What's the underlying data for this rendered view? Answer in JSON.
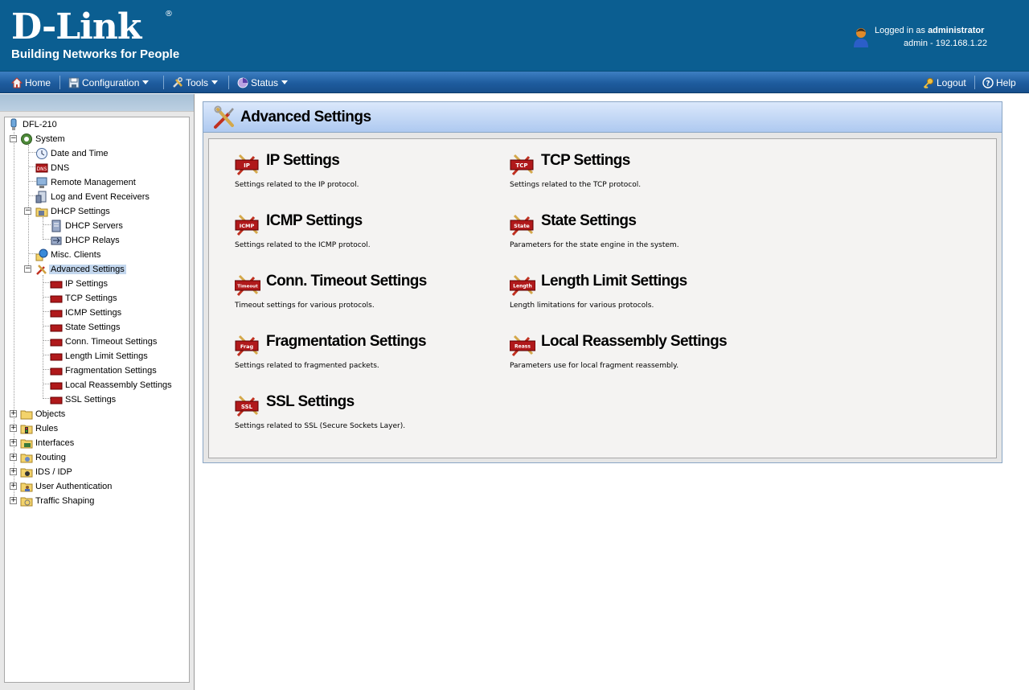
{
  "header": {
    "logo_text": "D-Link",
    "logo_reg": "®",
    "tagline": "Building Networks for People",
    "logged_in_prefix": "Logged in as",
    "username": "administrator",
    "session": "admin - 192.168.1.22"
  },
  "menu": {
    "home": "Home",
    "configuration": "Configuration",
    "tools": "Tools",
    "status": "Status",
    "logout": "Logout",
    "help": "Help"
  },
  "tree": {
    "root": "DFL-210",
    "system": "System",
    "date_time": "Date and Time",
    "dns": "DNS",
    "remote_mgmt": "Remote Management",
    "log_receivers": "Log and Event Receivers",
    "dhcp_settings": "DHCP Settings",
    "dhcp_servers": "DHCP Servers",
    "dhcp_relays": "DHCP Relays",
    "misc_clients": "Misc. Clients",
    "advanced_settings": "Advanced Settings",
    "ip_settings": "IP Settings",
    "tcp_settings": "TCP Settings",
    "icmp_settings": "ICMP Settings",
    "state_settings": "State Settings",
    "conn_timeout": "Conn. Timeout Settings",
    "length_limit": "Length Limit Settings",
    "fragmentation": "Fragmentation Settings",
    "local_reassembly": "Local Reassembly Settings",
    "ssl_settings": "SSL Settings",
    "objects": "Objects",
    "rules": "Rules",
    "interfaces": "Interfaces",
    "routing": "Routing",
    "ids_idp": "IDS / IDP",
    "user_auth": "User Authentication",
    "traffic_shaping": "Traffic Shaping"
  },
  "panel": {
    "title": "Advanced Settings",
    "settings": [
      {
        "badge": "IP",
        "title": "IP Settings",
        "desc": "Settings related to the IP protocol."
      },
      {
        "badge": "TCP",
        "title": "TCP Settings",
        "desc": "Settings related to the TCP protocol."
      },
      {
        "badge": "ICMP",
        "title": "ICMP Settings",
        "desc": "Settings related to the ICMP protocol."
      },
      {
        "badge": "State",
        "title": "State Settings",
        "desc": "Parameters for the state engine in the system."
      },
      {
        "badge": "Timeout",
        "title": "Conn. Timeout Settings",
        "desc": "Timeout settings for various protocols."
      },
      {
        "badge": "Length",
        "title": "Length Limit Settings",
        "desc": "Length limitations for various protocols."
      },
      {
        "badge": "Frag",
        "title": "Fragmentation Settings",
        "desc": "Settings related to fragmented packets."
      },
      {
        "badge": "Reass",
        "title": "Local Reassembly Settings",
        "desc": "Parameters use for local fragment reassembly."
      },
      {
        "badge": "SSL",
        "title": "SSL Settings",
        "desc": "Settings related to SSL (Secure Sockets Layer)."
      }
    ]
  },
  "colors": {
    "header_bg": "#0b5e91",
    "menubar": "#1e5c9e",
    "badge_red": "#b0191b",
    "selected": "#c3d7ee"
  }
}
